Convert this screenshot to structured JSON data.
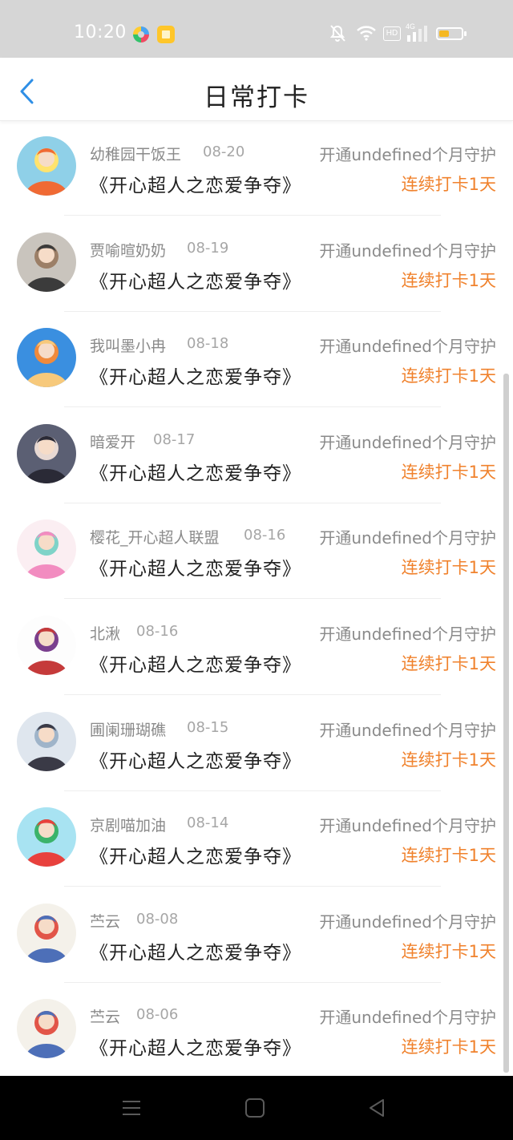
{
  "status_bar": {
    "time": "10:20",
    "app_icons": [
      "colorful-app-icon",
      "yellow-app-icon"
    ],
    "hd_label": "HD",
    "network_label": "4G",
    "battery_level": 0.45,
    "battery_color": "#f5b821"
  },
  "header": {
    "title": "日常打卡",
    "back_icon": "chevron-left-icon",
    "accent_color": "#2f8fe6"
  },
  "colors": {
    "name_gray": "#8a8a8a",
    "title_text": "#222222",
    "streak_orange": "#f0822d"
  },
  "checkins": [
    {
      "name": "幼稚园干饭王",
      "date": "08-20",
      "title": "《开心超人之恋爱争夺》",
      "guard": "开通undefined个月守护",
      "streak": "连续打卡1天",
      "avatar": {
        "bg": "#8fd0e8",
        "fg": "#f06a34",
        "accent": "#ffe36e"
      }
    },
    {
      "name": "贾喻暄奶奶",
      "date": "08-19",
      "title": "《开心超人之恋爱争夺》",
      "guard": "开通undefined个月守护",
      "streak": "连续打卡1天",
      "avatar": {
        "bg": "#c9c4bd",
        "fg": "#3b3b3b",
        "accent": "#9c7f67"
      }
    },
    {
      "name": "我叫墨小冉",
      "date": "08-18",
      "title": "《开心超人之恋爱争夺》",
      "guard": "开通undefined个月守护",
      "streak": "连续打卡1天",
      "avatar": {
        "bg": "#3a8fe0",
        "fg": "#f7c97b",
        "accent": "#f08a3c"
      }
    },
    {
      "name": "暗爱开",
      "date": "08-17",
      "title": "《开心超人之恋爱争夺》",
      "guard": "开通undefined个月守护",
      "streak": "连续打卡1天",
      "avatar": {
        "bg": "#5b5f73",
        "fg": "#2a2a36",
        "accent": "#e8d9d3"
      }
    },
    {
      "name": "樱花_开心超人联盟",
      "date": "08-16",
      "title": "《开心超人之恋爱争夺》",
      "guard": "开通undefined个月守护",
      "streak": "连续打卡1天",
      "avatar": {
        "bg": "#fbeef2",
        "fg": "#f28cc0",
        "accent": "#7fd3c8"
      }
    },
    {
      "name": "北湫",
      "date": "08-16",
      "title": "《开心超人之恋爱争夺》",
      "guard": "开通undefined个月守护",
      "streak": "连续打卡1天",
      "avatar": {
        "bg": "#fdfdfd",
        "fg": "#c53a3a",
        "accent": "#7a3f8e"
      }
    },
    {
      "name": "圃阑珊瑚礁",
      "date": "08-15",
      "title": "《开心超人之恋爱争夺》",
      "guard": "开通undefined个月守护",
      "streak": "连续打卡1天",
      "avatar": {
        "bg": "#dfe6ee",
        "fg": "#3a3a46",
        "accent": "#9fb4c9"
      }
    },
    {
      "name": "京剧喵加油",
      "date": "08-14",
      "title": "《开心超人之恋爱争夺》",
      "guard": "开通undefined个月守护",
      "streak": "连续打卡1天",
      "avatar": {
        "bg": "#a8e3f2",
        "fg": "#e8413d",
        "accent": "#3bb36a"
      }
    },
    {
      "name": "苎云",
      "date": "08-08",
      "title": "《开心超人之恋爱争夺》",
      "guard": "开通undefined个月守护",
      "streak": "连续打卡1天",
      "avatar": {
        "bg": "#f4f1ea",
        "fg": "#4d6fb8",
        "accent": "#e25548"
      }
    },
    {
      "name": "苎云",
      "date": "08-06",
      "title": "《开心超人之恋爱争夺》",
      "guard": "开通undefined个月守护",
      "streak": "连续打卡1天",
      "avatar": {
        "bg": "#f4f1ea",
        "fg": "#4d6fb8",
        "accent": "#e25548"
      }
    }
  ],
  "nav_bar": {
    "buttons": [
      "menu-icon",
      "home-icon",
      "back-triangle-icon"
    ]
  }
}
